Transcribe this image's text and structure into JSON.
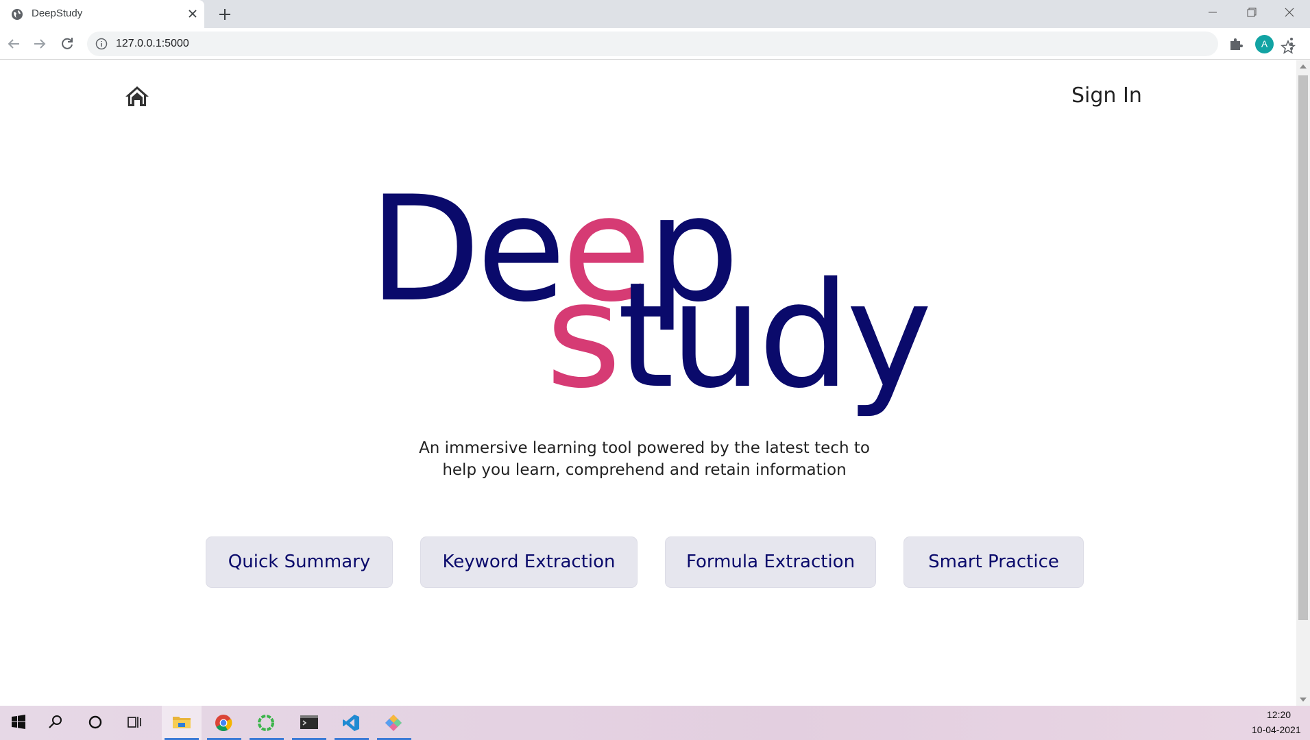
{
  "browser": {
    "tab_title": "DeepStudy",
    "url": "127.0.0.1:5000",
    "profile_initial": "A"
  },
  "page": {
    "signin": "Sign In",
    "logo_line1_prefix": "De",
    "logo_line1_accent": "e",
    "logo_line1_suffix": "p",
    "logo_line2_accent": "s",
    "logo_line2_suffix": "tudy",
    "tagline_line1": "An immersive learning tool powered by the latest tech to",
    "tagline_line2": "help you learn, comprehend and retain information",
    "features": [
      "Quick Summary",
      "Keyword Extraction",
      "Formula Extraction",
      "Smart Practice"
    ]
  },
  "colors": {
    "brand_navy": "#0a0a6b",
    "brand_pink": "#d63b74",
    "button_bg": "#e6e6ee"
  },
  "taskbar": {
    "time": "12:20",
    "date": "10-04-2021",
    "apps": [
      "windows-start-icon",
      "search-icon",
      "cortana-icon",
      "task-view-icon",
      "file-explorer-icon",
      "chrome-icon",
      "loader-app-icon",
      "terminal-icon",
      "vscode-icon",
      "git-app-icon"
    ]
  }
}
